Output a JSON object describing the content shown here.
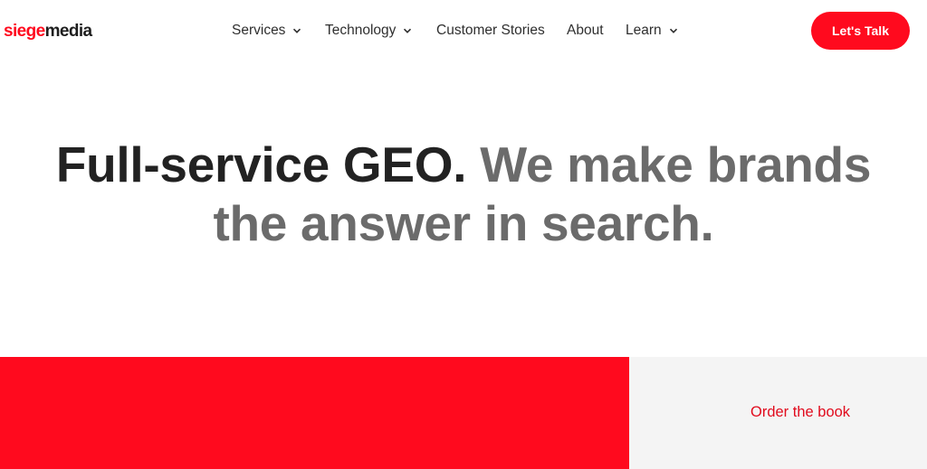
{
  "header": {
    "logo": {
      "part1": "siege",
      "part2": "media"
    },
    "nav": [
      {
        "label": "Services",
        "has_dropdown": true
      },
      {
        "label": "Technology",
        "has_dropdown": true
      },
      {
        "label": "Customer Stories",
        "has_dropdown": false
      },
      {
        "label": "About",
        "has_dropdown": false
      },
      {
        "label": "Learn",
        "has_dropdown": true
      }
    ],
    "cta_label": "Let's Talk"
  },
  "hero": {
    "headline_dark": "Full-service GEO.",
    "headline_gray_line1": "We make brands",
    "headline_gray_line2": "the answer in search."
  },
  "promo": {
    "order_link": "Order the book"
  },
  "colors": {
    "brand_red": "#ff0a1e",
    "text_dark": "#222222",
    "text_gray": "#6b6b6b",
    "panel_gray": "#f4f4f4"
  },
  "icons": {
    "dropdown": "chevron-down-icon"
  }
}
